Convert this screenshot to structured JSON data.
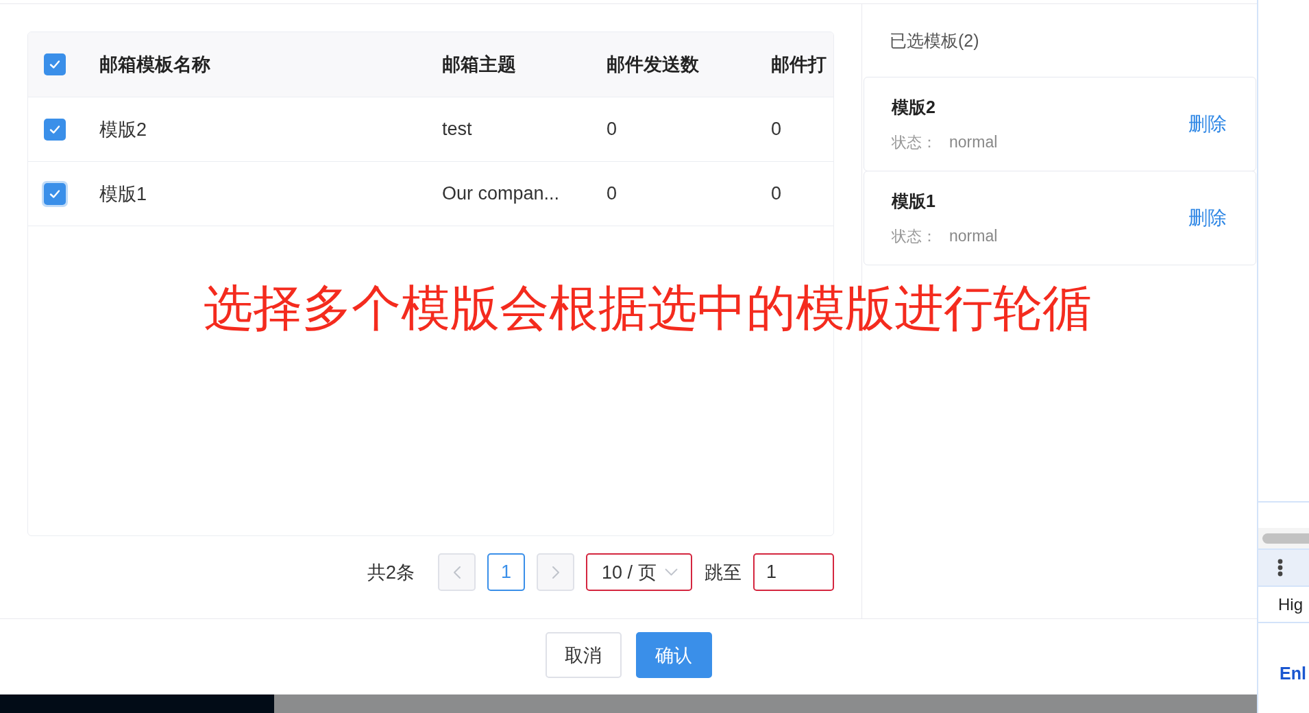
{
  "table": {
    "select_all_checked": true,
    "columns": [
      "邮箱模板名称",
      "邮箱主题",
      "邮件发送数",
      "邮件打"
    ],
    "rows": [
      {
        "selected": true,
        "focused": false,
        "cells": [
          "模版2",
          "test",
          "0",
          "0"
        ]
      },
      {
        "selected": true,
        "focused": true,
        "cells": [
          "模版1",
          "Our compan...",
          "0",
          "0"
        ]
      }
    ]
  },
  "pagination": {
    "total": "共2条",
    "prev_disabled": true,
    "pages": [
      {
        "label": "1",
        "selected": true
      }
    ],
    "next_disabled": true,
    "page_size": {
      "value": "10 / 页",
      "invalid": true
    },
    "jump_label": "跳至",
    "jump_input": {
      "value": "1",
      "invalid": true
    }
  },
  "selected_panel": {
    "title": "已选模板(2)",
    "items": [
      {
        "name": "模版2",
        "status_label": "状态：",
        "status": "normal",
        "action": "删除"
      },
      {
        "name": "模版1",
        "status_label": "状态：",
        "status": "normal",
        "action": "删除"
      }
    ]
  },
  "annotation": "选择多个模版会根据选中的模版进行轮循",
  "footer": {
    "buttons": [
      {
        "label": "取消",
        "kind": "default"
      },
      {
        "label": "确认",
        "kind": "primary"
      }
    ]
  },
  "background_page": {
    "row_text": "Hig",
    "heading": "Enl"
  }
}
